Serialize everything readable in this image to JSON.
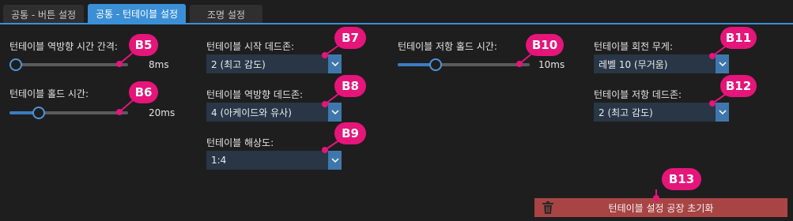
{
  "tabs": [
    {
      "label": "공통 - 버튼 설정",
      "active": false
    },
    {
      "label": "공통 - 턴테이블 설정",
      "active": true
    },
    {
      "label": "조명 설정",
      "active": false
    }
  ],
  "col1": {
    "reverse_interval": {
      "label": "턴테이블 역방향 시간 간격:",
      "value": "8ms",
      "level": 0.0
    },
    "hold_time": {
      "label": "턴테이블 홀드 시간:",
      "value": "20ms",
      "level": 0.2
    }
  },
  "col2": {
    "start_deadzone": {
      "label": "턴테이블 시작 데드존:",
      "selected": "2 (최고 감도)"
    },
    "reverse_deadzone": {
      "label": "턴테이블 역방향 데드존:",
      "selected": "4 (아케이드와 유사)"
    },
    "resolution": {
      "label": "턴테이블 해상도:",
      "selected": "1:4"
    }
  },
  "col3": {
    "resist_hold": {
      "label": "턴테이블 저항 홀드 시간:",
      "value": "10ms",
      "level": 0.25
    }
  },
  "col4": {
    "rotation_weight": {
      "label": "턴테이블 회전 무게:",
      "selected": "레벨 10 (무거움)"
    },
    "resist_deadzone": {
      "label": "턴테이블 저항 데드존:",
      "selected": "2 (최고 감도)"
    }
  },
  "reset_button": {
    "label": "턴테이블 설정 공장 초기화",
    "icon": "trash-icon"
  },
  "callouts": {
    "b5": "B5",
    "b6": "B6",
    "b7": "B7",
    "b8": "B8",
    "b9": "B9",
    "b10": "B10",
    "b11": "B11",
    "b12": "B12",
    "b13": "B13"
  },
  "colors": {
    "accent": "#3b8fd6",
    "callout": "#e5157a",
    "reset": "#a84444",
    "combo_bg": "#283646"
  }
}
